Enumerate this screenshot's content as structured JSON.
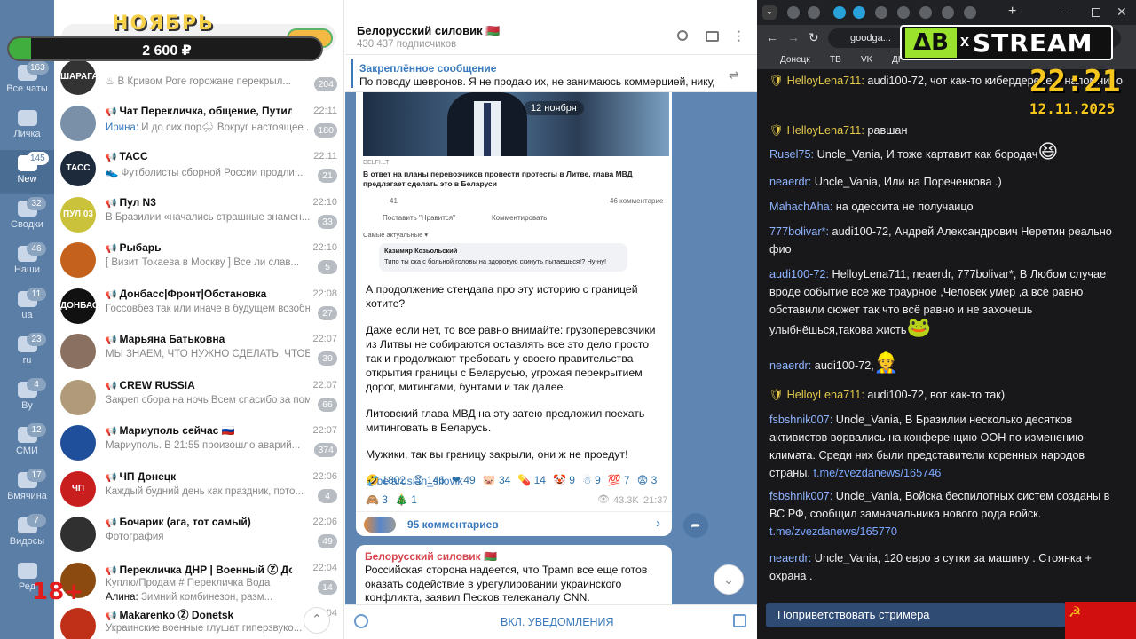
{
  "stream_overlay": {
    "month": "НОЯБРЬ",
    "goal_amount": "2 600 ₽",
    "goal_progress": 0.07,
    "age_rating": "18+",
    "logo_left": "ΔB",
    "logo_x": "x",
    "logo_right": "STREAM",
    "clock_time": "22:21",
    "clock_date": "12.11.2025"
  },
  "folders": [
    {
      "label": "Все чаты",
      "badge": "163",
      "icon": "chat-bubbles-icon"
    },
    {
      "label": "Личка",
      "badge": "",
      "icon": "folder-icon"
    },
    {
      "label": "New",
      "badge": "145",
      "icon": "folder-icon",
      "active": true
    },
    {
      "label": "Сводки",
      "badge": "32",
      "icon": "folder-icon"
    },
    {
      "label": "Наши",
      "badge": "46",
      "icon": "folder-icon"
    },
    {
      "label": "ua",
      "badge": "11",
      "icon": "folder-icon"
    },
    {
      "label": "ru",
      "badge": "23",
      "icon": "folder-icon"
    },
    {
      "label": "By",
      "badge": "4",
      "icon": "folder-icon"
    },
    {
      "label": "СМИ",
      "badge": "12",
      "icon": "folder-icon"
    },
    {
      "label": "Вмячина",
      "badge": "17",
      "icon": "folder-icon"
    },
    {
      "label": "Видосы",
      "badge": "7",
      "icon": "folder-icon"
    },
    {
      "label": "Ред",
      "badge": "",
      "icon": "edit-icon"
    }
  ],
  "chats": [
    {
      "name": "",
      "time": "",
      "preview": "♨ В Кривом Роге горожане перекрыл...",
      "badge": "204",
      "avatar": "ШАРАГА",
      "color": "#333333"
    },
    {
      "name": "Чат Перекличка, общение, Путиловка ...",
      "time": "22:11",
      "sender": "Ирина:",
      "preview": " И до сих пор🌧 Вокруг настоящее ...",
      "badge": "180",
      "avatar": "",
      "color": "#7a8fa8"
    },
    {
      "name": "ТАСС",
      "time": "22:11",
      "preview": "👟 Футболисты сборной России продли...",
      "badge": "21",
      "avatar": "ТАСС",
      "color": "#1d2a3c"
    },
    {
      "name": "Пул N3",
      "time": "22:10",
      "preview": "В Бразилии «начались страшные знамен...",
      "badge": "33",
      "avatar": "ПУЛ 03",
      "color": "#c9c23a"
    },
    {
      "name": "Рыбарь",
      "time": "22:10",
      "preview": "[ Визит Токаева в Москву ] Все ли слав...",
      "badge": "5",
      "avatar": "",
      "color": "#c4621d"
    },
    {
      "name": "Донбасс|Фронт|Обстановка",
      "time": "22:08",
      "preview": "Госсовбез так или иначе в будущем возобн...",
      "badge": "27",
      "avatar": "ДОНБАСС",
      "color": "#111111"
    },
    {
      "name": "Марьяна Батьковна",
      "time": "22:07",
      "preview": "МЫ ЗНАЕМ, ЧТО НУЖНО СДЕЛАТЬ, ЧТОБ...",
      "badge": "39",
      "avatar": "",
      "color": "#8a7060"
    },
    {
      "name": "CREW RUSSIA",
      "time": "22:07",
      "preview": "Закреп сбора на ночь Всем спасибо за пом...",
      "badge": "66",
      "avatar": "",
      "color": "#b09a7a"
    },
    {
      "name": "Мариуполь сейчас 🇷🇺",
      "time": "22:07",
      "preview": "Мариуполь. В 21:55 произошло аварий...",
      "badge": "374",
      "avatar": "",
      "color": "#1f4f9a"
    },
    {
      "name": "ЧП Донецк",
      "time": "22:06",
      "preview": "Каждый будний день как праздник, пото...",
      "badge": "4",
      "avatar": "ЧП",
      "color": "#c81e1e"
    },
    {
      "name": "Бочарик (ага, тот самый)",
      "time": "22:06",
      "preview": "Фотография",
      "badge": "49",
      "avatar": "",
      "color": "#303030"
    },
    {
      "name": "Перекличка ДНР | Военный Ⓩ Донецк",
      "time": "22:04",
      "preview": "Куплю/Продам # Перекличка Вода",
      "sender": "Алина:",
      "preview2": " Зимний комбинезон, разм...",
      "badge": "14",
      "avatar": "",
      "color": "#8a4a10"
    },
    {
      "name": "Makarenko Ⓩ Donetsk",
      "time": "22:04",
      "preview": "Украинские военные глушат гиперзвуко...",
      "badge": "",
      "avatar": "",
      "color": "#c03018"
    }
  ],
  "channel": {
    "title": "Белорусский силовик 🇧🇾",
    "subscribers": "430 437 подписчиков",
    "pinned_label": "Закреплённое сообщение",
    "pinned_text": "По поводу шевронов. Я не продаю их, не занимаюсь коммерцией, никуда ...",
    "date_badge": "12 ноября",
    "screenshot": {
      "source": "DELFI.LT",
      "headline": "В ответ на планы перевозчиков провести протесты в Литве, глава МВД предлагает сделать это в Беларуси",
      "reactions_count": "41",
      "comments_count": "46 комментарие",
      "like_btn": "Поставить \"Нравится\"",
      "comment_btn": "Комментировать",
      "sort_label": "Самые актуальные ▾",
      "commenter": "Казимир Козьольский",
      "comment": "Типо ты ска с больной головы на здоровую скинуть пытаешься!? Ну-ну!"
    },
    "post_paragraphs": [
      "А продолжение стендапа про эту историю с границей хотите?",
      "Даже если нет, то все равно внимайте: грузоперевозчики из Литвы не собираются оставлять все это дело просто так и продолжают требовать у своего правительства открытия границы с Беларусью, угрожая перекрытием дорог, митингами, бунтами и так далее.",
      "Литовский глава МВД на эту затею предложил поехать митинговать в Беларусь.",
      "Мужики, так вы границу закрыли, они ж не проедут!"
    ],
    "post_link": "@belarusian_silovik",
    "reactions": [
      {
        "emoji": "🤣",
        "count": "1802"
      },
      {
        "emoji": "😊",
        "count": "146"
      },
      {
        "emoji": "❤",
        "count": "49"
      },
      {
        "emoji": "🐷",
        "count": "34"
      },
      {
        "emoji": "💊",
        "count": "14"
      },
      {
        "emoji": "🤡",
        "count": "9"
      },
      {
        "emoji": "☃",
        "count": "9"
      },
      {
        "emoji": "💯",
        "count": "7"
      },
      {
        "emoji": "😨",
        "count": "3"
      },
      {
        "emoji": "🙈",
        "count": "3"
      },
      {
        "emoji": "🎄",
        "count": "1"
      }
    ],
    "views": "43.3K",
    "post_time": "21:37",
    "comments_link": "95 комментариев",
    "msg2_author": "Белорусский силовик 🇧🇾",
    "msg2_text": "Российская сторона надеется, что Трамп все еще готов оказать содействие в урегулировании украинского конфликта, заявил Песков телеканалу CNN.",
    "notify_button": "ВКЛ. УВЕДОМЛЕНИЯ"
  },
  "browser": {
    "address": "goodga...",
    "bookmarks": [
      "Донецк",
      "ТВ",
      "VK",
      "ДІ"
    ]
  },
  "stream_chat": [
    {
      "user": "HelloyLena711:",
      "badge": true,
      "color": "#e2c94a",
      "text": " audi100-72, чот как-то кибердереве... напомнило"
    },
    {
      "user": "HelloyLena711:",
      "badge": true,
      "color": "#e2c94a",
      "text": " равшан"
    },
    {
      "user": "Rusel75:",
      "color": "#8fb4ff",
      "text": " Uncle_Vania, И тоже картавит как бородач",
      "emote": "😆"
    },
    {
      "user": "neaerdr:",
      "color": "#8fb4ff",
      "text": " Uncle_Vania, Или на Пореченкова .)"
    },
    {
      "user": "MahachAha:",
      "color": "#8fb4ff",
      "text": " на одессита не получаицо"
    },
    {
      "user": "777bolivar*:",
      "color": "#8fb4ff",
      "text": " audi100-72, Андрей Александрович Неретин реально фио"
    },
    {
      "user": "audi100-72:",
      "color": "#8fb4ff",
      "text": " HelloyLena711, neaerdr, 777bolivar*, В Любом случае вроде событие всё же траурное ,Человек умер ,а всё равно обставили сюжет так что всё равно и не захочешь улыбнёшься,такова жисть",
      "emote": "🐸"
    },
    {
      "user": "neaerdr:",
      "color": "#8fb4ff",
      "text": " audi100-72,",
      "emote": "👷"
    },
    {
      "user": "HelloyLena711:",
      "badge": true,
      "color": "#e2c94a",
      "text": " audi100-72, вот как-то так)"
    },
    {
      "user": "fsbshnik007:",
      "color": "#8fb4ff",
      "text": " Uncle_Vania, В Бразилии несколько десятков активистов ворвались на конференцию ООН по изменению климата. Среди них были представители коренных народов страны. ",
      "link": "t.me/zvezdanews/165746"
    },
    {
      "user": "fsbshnik007:",
      "color": "#8fb4ff",
      "text": " Uncle_Vania, Войска беспилотных систем созданы в ВС РФ, сообщил замначальника нового рода войск. ",
      "link": "t.me/zvezdanews/165770"
    },
    {
      "user": "neaerdr:",
      "color": "#8fb4ff",
      "text": " Uncle_Vania, 120 евро в сутки за машину . Стоянка + охрана ."
    }
  ],
  "greet_button": "Поприветствовать стримера"
}
